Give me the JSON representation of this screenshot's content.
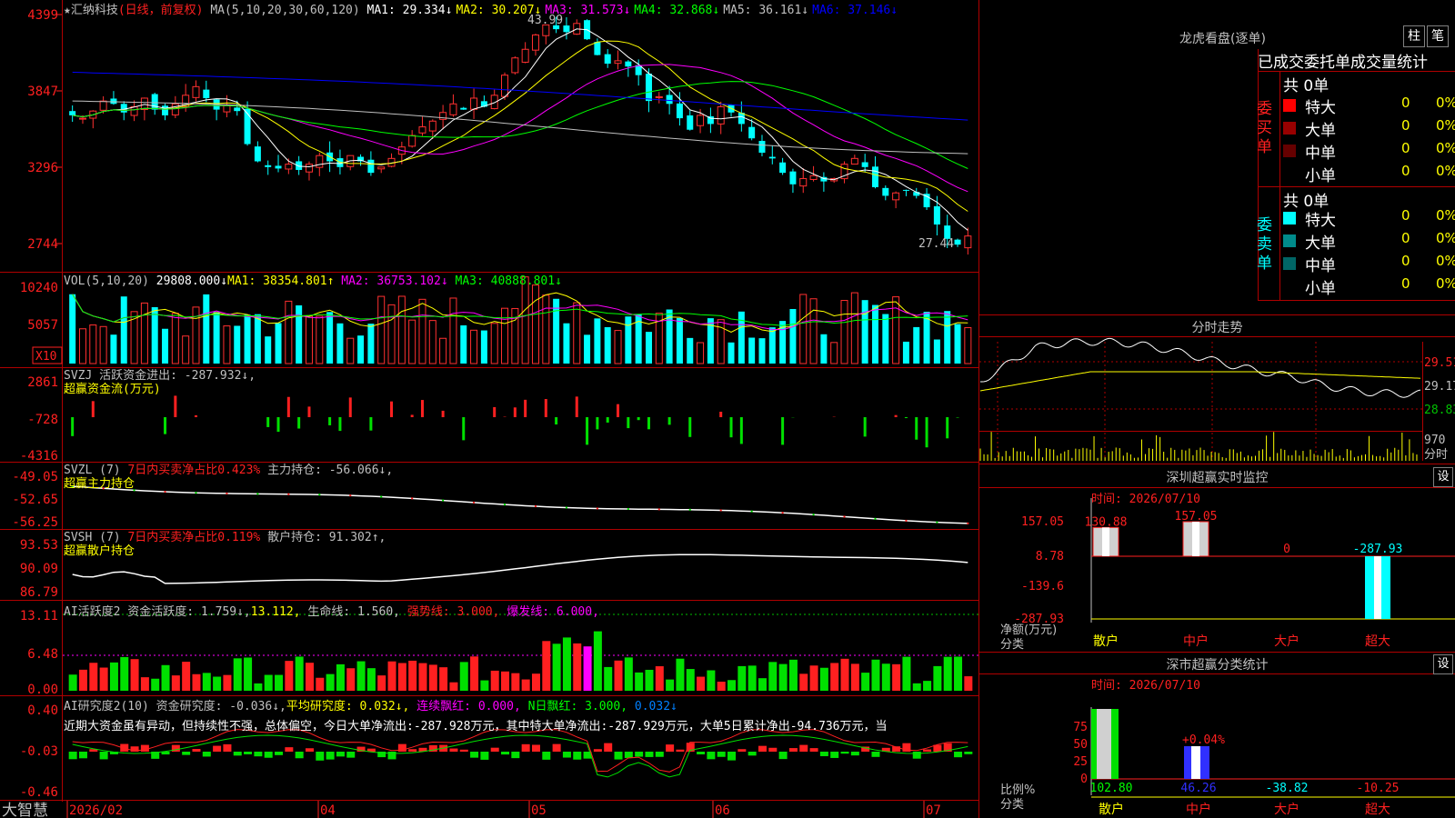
{
  "stock": {
    "name_line": "★汇纳科技",
    "mode": "(日线，前复权)",
    "ma_header": "MA(5,10,20,30,60,120)",
    "ma": [
      {
        "label": "MA1:",
        "value": "29.334",
        "arrow": "↓",
        "color": "#ffffff"
      },
      {
        "label": "MA2:",
        "value": "30.207",
        "arrow": "↓",
        "color": "#ffff00"
      },
      {
        "label": "MA3:",
        "value": "31.573",
        "arrow": "↓",
        "color": "#ff00ff"
      },
      {
        "label": "MA4:",
        "value": "32.868",
        "arrow": "↓",
        "color": "#00ff00"
      },
      {
        "label": "MA5:",
        "value": "36.161",
        "arrow": "↓",
        "color": "#c0c0c0"
      },
      {
        "label": "MA6:",
        "value": "37.146",
        "arrow": "↓",
        "color": "#0000ff"
      }
    ],
    "high_label": "43.99",
    "low_label": "27.44"
  },
  "price_axis": [
    "4399",
    "3847",
    "3296",
    "2744"
  ],
  "vol": {
    "header": "VOL(5,10,20)",
    "value": "29808.000↓",
    "ma1": "MA1: 38354.801↑",
    "ma2": "MA2: 36753.102↓",
    "ma3": "MA3: 40888.801↓",
    "axis": [
      "10240",
      "5057"
    ],
    "unit": "X10"
  },
  "svzj": {
    "title": "SVZJ 活跃资金进出: -287.932↓,",
    "subtitle": "超赢资金流(万元)",
    "axis": [
      "2861",
      "-728",
      "-4316"
    ]
  },
  "svzl": {
    "title_a": "SVZL (7)",
    "title_b": "7日内买卖净占比0.423%",
    "title_c": "主力持仓: -56.066↓,",
    "subtitle": "超赢主力持仓",
    "axis": [
      "-49.05",
      "-52.65",
      "-56.25"
    ]
  },
  "svsh": {
    "title_a": "SVSH (7)",
    "title_b": "7日内买卖净占比0.119%",
    "title_c": "散户持仓: 91.302↑,",
    "subtitle": "超赢散户持仓",
    "axis": [
      "93.53",
      "90.09",
      "86.79"
    ]
  },
  "ai1": {
    "title_a": "AI活跃度2 资金活跃度: 1.759↓,",
    "title_b": "13.112,",
    "title_c": "生命线: 1.560,",
    "title_d": "强势线: 3.000,",
    "title_e": "爆发线: 6.000,",
    "axis": [
      "13.11",
      "6.48",
      "0.00"
    ]
  },
  "ai2": {
    "title_a": "AI研究度2(10) 资金研究度: -0.036↓,",
    "title_b": "平均研究度: 0.032↓,",
    "title_c": "连续飘红: 0.000,",
    "title_d": "N日飘红: 3.000,",
    "title_e": "0.032↓",
    "comment": "近期大资金虽有异动，但持续性不强，总体偏空，今日大单净流出:-287.928万元，其中特大单净流出:-287.929万元，大单5日累计净出-94.736万元，当",
    "axis": [
      "0.40",
      "-0.03",
      "-0.46"
    ]
  },
  "date_axis": [
    "2026/02",
    "04",
    "05",
    "06",
    "07"
  ],
  "brand": "大智慧",
  "lhb": {
    "title": "龙虎看盘(逐单)",
    "btn_a": "柱",
    "btn_b": "笔",
    "tabs": "已成交委托单成交量统计",
    "buy_label": "委买单",
    "sell_label": "委卖单",
    "buy_total": "共 0单",
    "sell_total": "共 0单",
    "buy_rows": [
      {
        "name": "特大",
        "v": "0",
        "p": "0%",
        "color": "#ff0000"
      },
      {
        "name": "大单",
        "v": "0",
        "p": "0%",
        "color": "#990000"
      },
      {
        "name": "中单",
        "v": "0",
        "p": "0%",
        "color": "#660000"
      },
      {
        "name": "小单",
        "v": "0",
        "p": "0%",
        "color": ""
      }
    ],
    "sell_rows": [
      {
        "name": "特大",
        "v": "0",
        "p": "0%",
        "color": "#00ffff"
      },
      {
        "name": "大单",
        "v": "0",
        "p": "0%",
        "color": "#008b8b"
      },
      {
        "name": "中单",
        "v": "0",
        "p": "0%",
        "color": "#006666"
      },
      {
        "name": "小单",
        "v": "0",
        "p": "0%",
        "color": ""
      }
    ]
  },
  "fenshi": {
    "title": "分时走势",
    "axis": [
      "29.51",
      "29.17",
      "28.83"
    ],
    "vol_label": "970",
    "vol_unit": "分时"
  },
  "sz_monitor": {
    "title": "深圳超赢实时监控",
    "set": "设",
    "date": "时间: 2026/07/10",
    "axis": [
      "157.05",
      "8.78",
      "-139.6",
      "-287.93"
    ],
    "ylabel": "净额(万元)",
    "xlabel": "分类",
    "cats": [
      "散户",
      "中户",
      "大户",
      "超大"
    ],
    "values": [
      "130.88",
      "157.05",
      "0",
      "-287.93"
    ]
  },
  "sz_class": {
    "title": "深市超赢分类统计",
    "set": "设",
    "date": "时间: 2026/07/10",
    "axis": [
      "75",
      "50",
      "25",
      "0"
    ],
    "ylabel": "比例%",
    "xlabel": "分类",
    "cats": [
      "散户",
      "中户",
      "大户",
      "超大"
    ],
    "values": [
      "102.80",
      "46.26",
      "-38.82",
      "-10.25"
    ],
    "annot": "+0.04%"
  },
  "chart_data": {
    "type": "candlestick",
    "title": "★汇纳科技 (日线，前复权)",
    "ylim": [
      27.44,
      43.99
    ],
    "x_ticks": [
      "2026/02",
      "04",
      "05",
      "06",
      "07"
    ],
    "close_series": [
      37.2,
      37.0,
      37.5,
      38.2,
      38.0,
      37.4,
      37.8,
      38.4,
      37.6,
      37.2,
      38.0,
      38.6,
      39.2,
      38.4,
      37.6,
      37.9,
      37.5,
      35.2,
      34.0,
      33.6,
      33.5,
      33.8,
      33.4,
      33.8,
      34.4,
      34.0,
      33.6,
      34.4,
      34.0,
      33.2,
      33.6,
      34.2,
      35.0,
      35.8,
      36.4,
      36.8,
      37.4,
      38.0,
      37.6,
      38.4,
      37.8,
      38.6,
      40.0,
      41.2,
      41.8,
      42.8,
      43.5,
      43.2,
      43.0,
      43.6,
      42.5,
      41.4,
      40.8,
      41.0,
      40.6,
      40.0,
      38.2,
      38.5,
      38.0,
      37.0,
      36.2,
      37.2,
      36.6,
      37.8,
      37.4,
      36.6,
      35.6,
      34.6,
      34.2,
      33.2,
      32.4,
      32.8,
      33.0,
      32.6,
      32.8,
      33.8,
      34.2,
      33.6,
      32.2,
      31.6,
      31.8,
      32.0,
      31.6,
      30.8,
      29.6,
      28.6,
      28.2,
      28.8
    ]
  }
}
